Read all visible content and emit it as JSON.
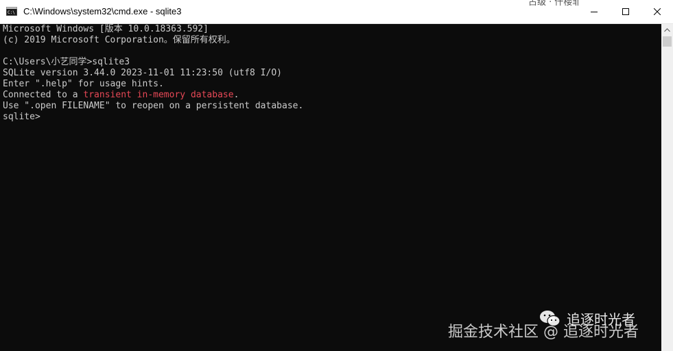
{
  "window": {
    "title": "C:\\Windows\\system32\\cmd.exe - sqlite3",
    "background_text": "占级 · 仟楼菲苣 · 名缘菲苣 ·"
  },
  "console": {
    "lines": [
      "Microsoft Windows [版本 10.0.18363.592]",
      "(c) 2019 Microsoft Corporation。保留所有权利。",
      "",
      "C:\\Users\\小艺同学>sqlite3",
      "SQLite version 3.44.0 2023-11-01 11:23:50 (utf8 I/O)",
      "Enter \".help\" for usage hints.",
      "Connected to a ",
      "Use \".open FILENAME\" to reopen on a persistent database.",
      "sqlite>"
    ],
    "highlight": "transient in-memory database",
    "after_highlight": "."
  },
  "watermark": {
    "account": "追逐时光者",
    "site": "掘金技术社区 @ 追逐时光者"
  },
  "colors": {
    "console_bg": "#0c0c0c",
    "console_text": "#cccccc",
    "highlight": "#e74856"
  },
  "icons": {
    "app": "cmd-icon",
    "minimize": "minimize-icon",
    "maximize": "maximize-icon",
    "close": "close-icon",
    "scroll_up": "scroll-up-arrow-icon",
    "wechat": "wechat-icon"
  }
}
